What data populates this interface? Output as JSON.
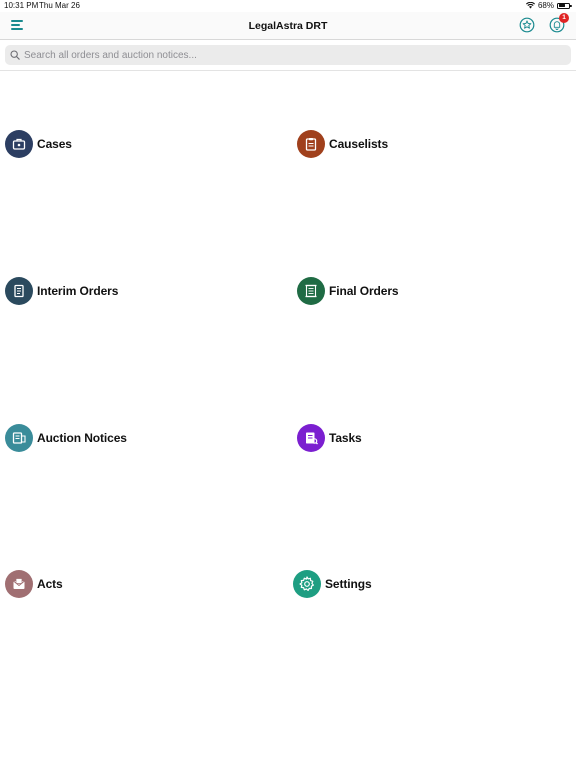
{
  "status_bar": {
    "time": "10:31 PM",
    "date": "Thu Mar 26",
    "battery": "68%",
    "battery_level": 0.68
  },
  "header": {
    "title": "LegalAstra DRT",
    "notification_count": "1"
  },
  "search": {
    "placeholder": "Search all orders and auction notices..."
  },
  "colors": {
    "accent": "#1a8a8f",
    "cases": "#2c3e62",
    "causelists": "#a0401c",
    "interim_orders": "#2b4a5e",
    "final_orders": "#1f6b44",
    "auction_notices": "#3a8c9a",
    "tasks": "#7b1fd0",
    "acts": "#a06f72",
    "settings": "#1e9e82"
  },
  "tiles": [
    {
      "label": "Cases",
      "icon": "briefcase-icon"
    },
    {
      "label": "Causelists",
      "icon": "clipboard-icon"
    },
    {
      "label": "Interim Orders",
      "icon": "document-icon"
    },
    {
      "label": "Final Orders",
      "icon": "scroll-icon"
    },
    {
      "label": "Auction Notices",
      "icon": "notice-icon"
    },
    {
      "label": "Tasks",
      "icon": "task-list-icon"
    },
    {
      "label": "Acts",
      "icon": "envelope-icon"
    },
    {
      "label": "Settings",
      "icon": "gear-icon"
    }
  ]
}
